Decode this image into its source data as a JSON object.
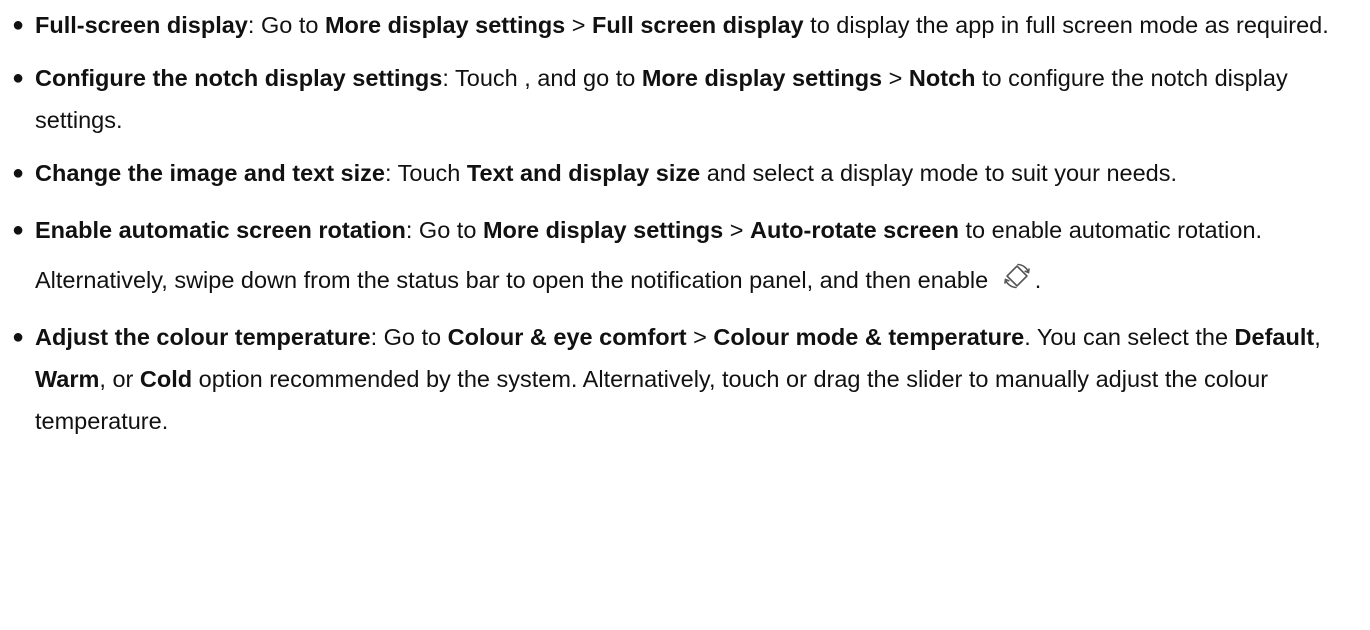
{
  "bullets": [
    {
      "title": "Full-screen display",
      "s1": ": Go to ",
      "b1": "More display settings",
      "s2": " > ",
      "b2": "Full screen display",
      "s3": " to display the app in full screen mode as required."
    },
    {
      "title": "Configure the notch display settings",
      "s1": ": Touch , and go to ",
      "b1": "More display settings",
      "s2": " > ",
      "b2": "Notch",
      "s3": " to configure the notch display settings."
    },
    {
      "title": "Change the image and text size",
      "s1": ": Touch ",
      "b1": "Text and display size",
      "s2": " and select a display mode to suit your needs."
    },
    {
      "title": "Enable automatic screen rotation",
      "s1": ": Go to ",
      "b1": "More display settings",
      "s2": " > ",
      "b2": "Auto-rotate screen",
      "s3": " to enable automatic rotation. Alternatively, swipe down from the status bar to open the notification panel, and then enable ",
      "icon": "auto-rotate-icon",
      "s4": "."
    },
    {
      "title": "Adjust the colour temperature",
      "s1": ": Go to ",
      "b1": "Colour & eye comfort",
      "s2": " > ",
      "b2": "Colour mode & temperature",
      "s3": ". You can select the ",
      "b3": "Default",
      "s4": ", ",
      "b4": "Warm",
      "s5": ", or ",
      "b5": "Cold",
      "s6": " option recommended by the system. Alternatively, touch or drag the slider to manually adjust the colour temperature."
    }
  ]
}
